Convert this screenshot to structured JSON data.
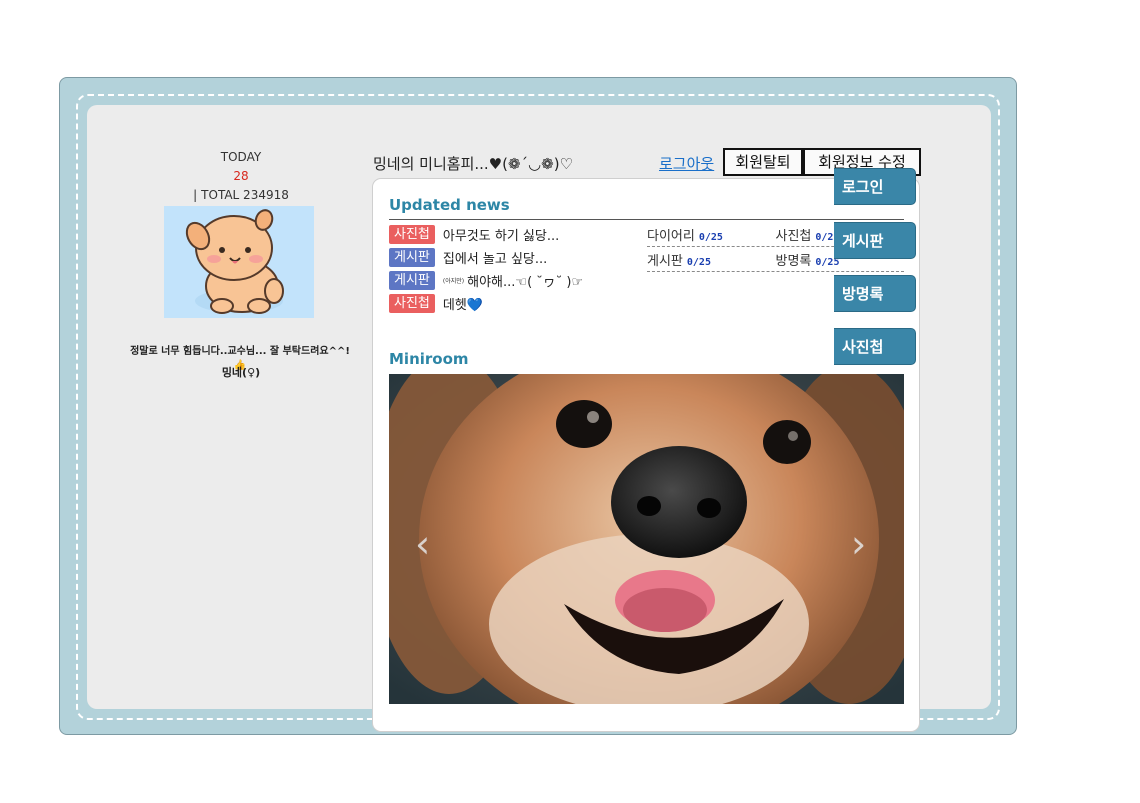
{
  "left": {
    "today_label": "TODAY",
    "today_value": "28",
    "total_prefix": "|",
    "total_text": "TOTAL 234918",
    "intro": "정말로 너무 힘듭니다..교수님... 잘 부탁드려요^^!👍",
    "name": "밍네(♀)"
  },
  "header": {
    "title": "밍네의 미니홈피...♥(❁´◡❁)♡",
    "logout": "로그아웃",
    "withdraw": "회원탈퇴",
    "edit_profile": "회원정보 수정"
  },
  "news": {
    "title": "Updated news",
    "items": [
      {
        "tag": "사진첩",
        "tag_type": "photo",
        "small": "",
        "text": "아무것도 하기 싫당..."
      },
      {
        "tag": "게시판",
        "tag_type": "board",
        "small": "",
        "text": "집에서 놀고 싶당..."
      },
      {
        "tag": "게시판",
        "tag_type": "board",
        "small": "(아지만)",
        "text": "해야해...☜( ˘ヮ˘ )☞"
      },
      {
        "tag": "사진첩",
        "tag_type": "photo",
        "small": "",
        "text": "데헷💙"
      }
    ]
  },
  "stats": [
    {
      "label": "다이어리",
      "count": "0/25"
    },
    {
      "label": "사진첩",
      "count": "0/25"
    },
    {
      "label": "게시판",
      "count": "0/25"
    },
    {
      "label": "방명록",
      "count": "0/25"
    }
  ],
  "miniroom": {
    "title": "Miniroom",
    "prev_icon": "chevron-left-icon",
    "next_icon": "chevron-right-icon",
    "prev_glyph": "‹",
    "next_glyph": "›"
  },
  "nav": [
    "로그인",
    "게시판",
    "방명록",
    "사진첩"
  ],
  "colors": {
    "frame": "#b3d2da",
    "panel": "#ececec",
    "accent": "#2d86a6",
    "nav": "#3a86a8",
    "tag_photo": "#ea5f5f",
    "tag_board": "#5d76c4",
    "today": "#d8281e"
  }
}
